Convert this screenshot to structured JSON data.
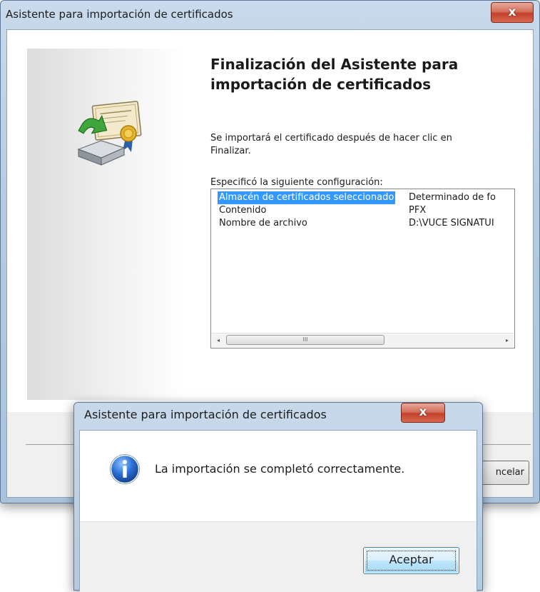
{
  "wizard": {
    "title": "Asistente para importación de certificados",
    "close_glyph": "x",
    "heading_line1": "Finalización del Asistente para",
    "heading_line2": "importación de certificados",
    "paragraph_line1": "Se importará el certificado después de hacer clic en",
    "paragraph_line2": "Finalizar.",
    "config_label": "Especificó la siguiente configuración:",
    "settings": [
      {
        "name": "Almacén de certificados seleccionado",
        "value": "Determinado de fo",
        "selected": true
      },
      {
        "name": "Contenido",
        "value": "PFX",
        "selected": false
      },
      {
        "name": "Nombre de archivo",
        "value": "D:\\VUCE SIGNATUI",
        "selected": false
      }
    ],
    "scroll_left": "◂",
    "scroll_right": "▸",
    "scroll_grip": "III",
    "cancel_button_partial": "ncelar",
    "icon": "certificate-import-icon"
  },
  "message_box": {
    "title": "Asistente para importación de certificados",
    "close_glyph": "x",
    "message": "La importación se completó correctamente.",
    "ok_label": "Aceptar",
    "icon": "info-icon"
  }
}
